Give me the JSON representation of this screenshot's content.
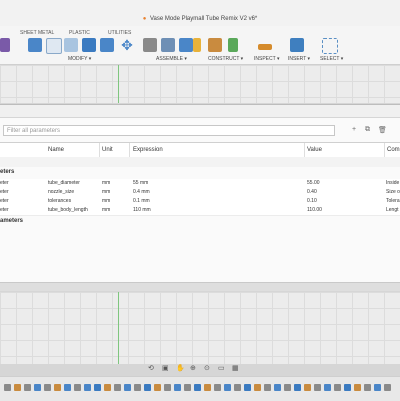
{
  "window": {
    "title": "Vase Mode Playmall Tube Remix V2 v6*"
  },
  "ribbon": {
    "tabs": [
      "SHEET METAL",
      "PLASTIC",
      "UTILITIES"
    ],
    "groups": [
      "MODIFY ▾",
      "ASSEMBLE ▾",
      "CONSTRUCT ▾",
      "INSPECT ▾",
      "INSERT ▾",
      "SELECT ▾"
    ]
  },
  "params_dialog": {
    "filter_placeholder": "Filter all parameters",
    "columns": [
      "Name",
      "Unit",
      "Expression",
      "Value",
      "Com"
    ],
    "group_user": "eters",
    "rows": [
      {
        "type_frag": "eter",
        "name": "tube_diameter",
        "unit": "mm",
        "expression": "55 mm",
        "value": "55.00",
        "comment": "Inside"
      },
      {
        "type_frag": "eter",
        "name": "nozzle_size",
        "unit": "mm",
        "expression": "0.4 mm",
        "value": "0.40",
        "comment": "Size o"
      },
      {
        "type_frag": "eter",
        "name": "tolerances",
        "unit": "mm",
        "expression": "0.1 mm",
        "value": "0.10",
        "comment": "Tolera"
      },
      {
        "type_frag": "eter",
        "name": "tube_body_length",
        "unit": "mm",
        "expression": "110 mm",
        "value": "110.00",
        "comment": "Lengt"
      }
    ],
    "group_model": "ameters"
  },
  "icons": [
    "fusion-doc-icon",
    "add-icon",
    "duplicate-icon",
    "delete-icon",
    "orbit-icon",
    "pan-icon",
    "zoom-icon",
    "display-icon",
    "grid-icon"
  ]
}
